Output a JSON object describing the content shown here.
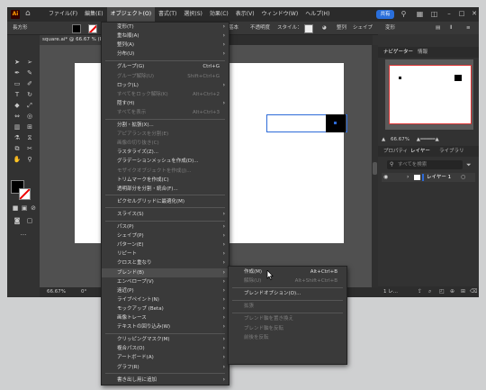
{
  "app": {
    "logo": "Ai",
    "menus": [
      {
        "id": "file",
        "label": "ファイル(F)"
      },
      {
        "id": "edit",
        "label": "編集(E)"
      },
      {
        "id": "object",
        "label": "オブジェクト(O)",
        "active": true
      },
      {
        "id": "type",
        "label": "書式(T)"
      },
      {
        "id": "select",
        "label": "選択(S)"
      },
      {
        "id": "effect",
        "label": "効果(C)"
      },
      {
        "id": "view",
        "label": "表示(V)"
      },
      {
        "id": "window",
        "label": "ウィンドウ(W)"
      },
      {
        "id": "help",
        "label": "ヘルプ(H)"
      }
    ],
    "share_label": "共有"
  },
  "control_bar": {
    "shape_label": "長方形",
    "basic_label": "基本",
    "opacity_label": "不透明度",
    "style_label": "スタイル：",
    "align_label": "整列",
    "shape_label2": "シェイプ",
    "transform_label": "変形"
  },
  "document": {
    "tab_title": "square.ai* @ 66.67 % (RGB"
  },
  "status": {
    "zoom": "66.67%",
    "rotation": "0°"
  },
  "panels": {
    "top_tabs": [
      "ナビゲーター",
      "情報"
    ],
    "zoom": "66.67%",
    "layer_tabs": [
      "プロパティ",
      "レイヤー",
      "ライブラリ"
    ],
    "search_placeholder": "すべてを検索",
    "layer_name": "レイヤー 1",
    "footer_label": "1 レ..."
  },
  "object_menu": [
    {
      "label": "変形(T)",
      "submenu": true
    },
    {
      "label": "重ね順(A)",
      "submenu": true
    },
    {
      "label": "整列(A)",
      "submenu": true
    },
    {
      "label": "分布(U)",
      "submenu": true
    },
    {
      "sep": true
    },
    {
      "label": "グループ(G)",
      "shortcut": "Ctrl+G"
    },
    {
      "label": "グループ解除(U)",
      "shortcut": "Shift+Ctrl+G",
      "disabled": true
    },
    {
      "label": "ロック(L)",
      "submenu": true
    },
    {
      "label": "すべてをロック解除(K)",
      "shortcut": "Alt+Ctrl+2",
      "disabled": true
    },
    {
      "label": "隠す(H)",
      "submenu": true
    },
    {
      "label": "すべてを表示",
      "shortcut": "Alt+Ctrl+3",
      "disabled": true
    },
    {
      "sep": true
    },
    {
      "label": "分割・拡張(X)..."
    },
    {
      "label": "アピアランスを分割(E)",
      "disabled": true
    },
    {
      "label": "画像の切り抜き(C)",
      "disabled": true
    },
    {
      "label": "ラスタライズ(Z)..."
    },
    {
      "label": "グラデーションメッシュを作成(D)..."
    },
    {
      "label": "モザイクオブジェクトを作成(J)...",
      "disabled": true
    },
    {
      "label": "トリムマークを作成(C)"
    },
    {
      "label": "透明部分を分割・統合(F)..."
    },
    {
      "sep": true
    },
    {
      "label": "ピクセルグリッドに最適化(M)"
    },
    {
      "sep": true
    },
    {
      "label": "スライス(S)",
      "submenu": true
    },
    {
      "sep": true
    },
    {
      "label": "パス(P)",
      "submenu": true
    },
    {
      "label": "シェイプ(P)",
      "submenu": true
    },
    {
      "label": "パターン(E)",
      "submenu": true
    },
    {
      "label": "リピート",
      "submenu": true
    },
    {
      "label": "クロスと重なり",
      "submenu": true
    },
    {
      "label": "ブレンド(B)",
      "submenu": true,
      "highlighted": true
    },
    {
      "label": "エンベロープ(V)",
      "submenu": true
    },
    {
      "label": "遠近(P)",
      "submenu": true
    },
    {
      "label": "ライブペイント(N)",
      "submenu": true
    },
    {
      "label": "モックアップ (Beta)",
      "submenu": true
    },
    {
      "label": "画像トレース",
      "submenu": true
    },
    {
      "label": "テキストの回り込み(W)",
      "submenu": true
    },
    {
      "sep": true
    },
    {
      "label": "クリッピングマスク(M)",
      "submenu": true
    },
    {
      "label": "複合パス(O)",
      "submenu": true
    },
    {
      "label": "アートボード(A)",
      "submenu": true
    },
    {
      "label": "グラフ(R)",
      "submenu": true
    },
    {
      "sep": true
    },
    {
      "label": "書き出し用に追加",
      "submenu": true
    }
  ],
  "blend_submenu": [
    {
      "label": "作成(M)",
      "shortcut": "Alt+Ctrl+B"
    },
    {
      "label": "解除(U)",
      "shortcut": "Alt+Shift+Ctrl+B",
      "disabled": true
    },
    {
      "sep": true
    },
    {
      "label": "ブレンドオプション(O)..."
    },
    {
      "sep": true
    },
    {
      "label": "拡張",
      "disabled": true
    },
    {
      "sep": true
    },
    {
      "label": "ブレンド軸を置き換え",
      "disabled": true
    },
    {
      "label": "ブレンド軸を反転",
      "disabled": true
    },
    {
      "label": "前後を反転",
      "disabled": true
    }
  ]
}
